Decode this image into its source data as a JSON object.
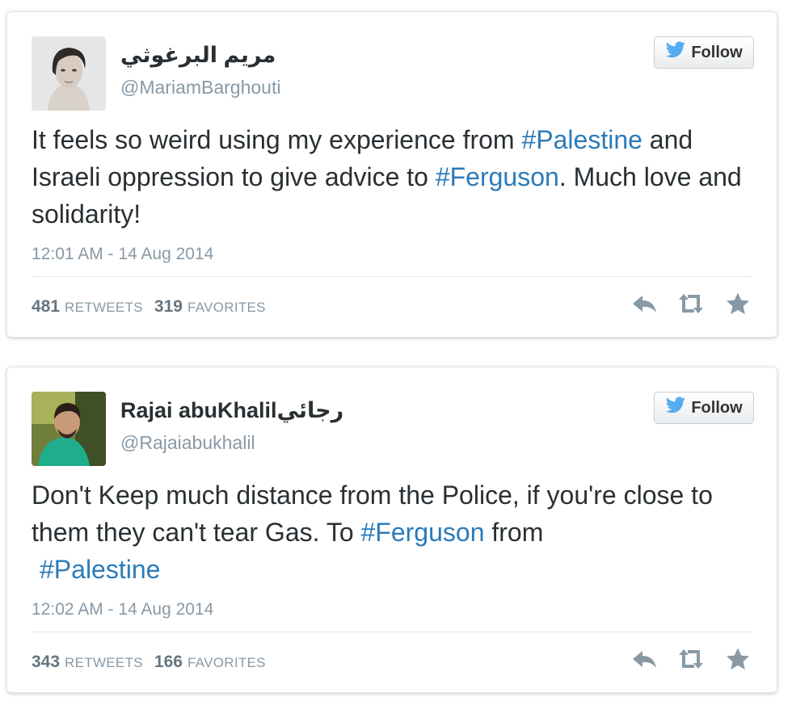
{
  "colors": {
    "hashtag": "#2b7bb9",
    "meta_gray": "#8899a6",
    "text": "#292f33",
    "icon_gray": "#8899a6"
  },
  "tweets": [
    {
      "display_name": "مريم البرغوثي",
      "handle": "@MariamBarghouti",
      "follow_label": "Follow",
      "text_parts": [
        "It feels so weird using my experience from ",
        "#Palestine",
        " and Israeli oppression to give advice to ",
        "#Ferguson",
        ". Much love and solidarity!"
      ],
      "timestamp": "12:01 AM - 14 Aug 2014",
      "retweets_count": "481",
      "retweets_label": "RETWEETS",
      "favorites_count": "319",
      "favorites_label": "FAVORITES",
      "icons": [
        "bird-icon",
        "reply-icon",
        "retweet-icon",
        "favorite-star-icon"
      ]
    },
    {
      "display_name": "Rajai abuKhalilرجائي",
      "handle": "@Rajaiabukhalil",
      "follow_label": "Follow",
      "text_parts": [
        "Don't Keep much distance from the Police, if you're close to them they can't tear Gas. To ",
        "#Ferguson",
        " from ",
        "#Palestine"
      ],
      "timestamp": "12:02 AM - 14 Aug 2014",
      "retweets_count": "343",
      "retweets_label": "RETWEETS",
      "favorites_count": "166",
      "favorites_label": "FAVORITES",
      "icons": [
        "bird-icon",
        "reply-icon",
        "retweet-icon",
        "favorite-star-icon"
      ]
    }
  ]
}
